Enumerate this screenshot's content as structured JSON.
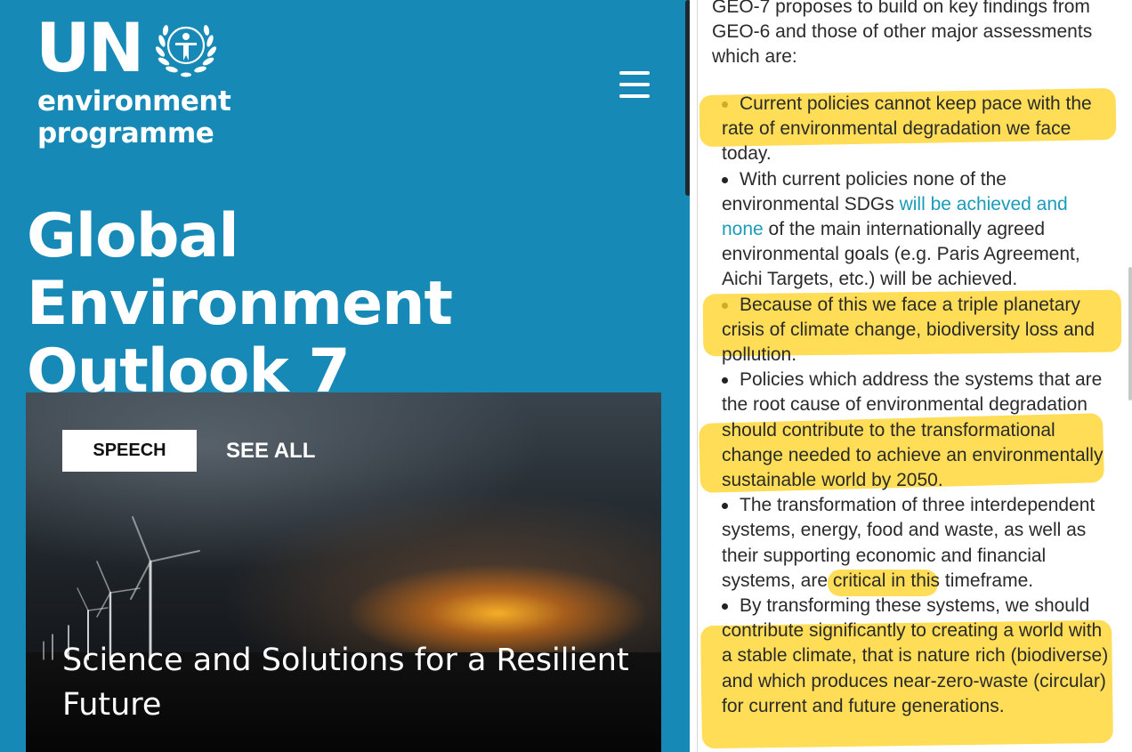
{
  "colors": {
    "brand_blue": "#1689b6",
    "highlight": "#ffd426",
    "link": "#1a9bb8"
  },
  "header": {
    "logo_un": "UN",
    "logo_line1": "environment",
    "logo_line2": "programme",
    "emblem_icon": "un-laurel-emblem-icon",
    "menu_icon": "hamburger-menu-icon"
  },
  "main": {
    "title_line1": "Global Environment",
    "title_line2": "Outlook 7"
  },
  "hero": {
    "tag_label": "SPEECH",
    "see_all_label": "SEE ALL",
    "headline_line1": "Science and Solutions for a Resilient",
    "headline_line2": "Future"
  },
  "article": {
    "intro_line1": "GEO-7 proposes to build on key findings from",
    "intro_line2": "GEO-6 and those of other major assessments",
    "intro_line3": "which are:",
    "findings": [
      {
        "text": "Current policies cannot keep pace with the rate of environmental degradation we face today."
      },
      {
        "text_before": "With current policies none of the environmental SDGs ",
        "link_text": "will be achieved and none",
        "text_after": " of the main internationally agreed environmental goals (e.g. Paris Agreement, Aichi Targets, etc.) will be achieved."
      },
      {
        "text": "Because of this we face a triple planetary crisis of climate change, biodiversity loss and pollution."
      },
      {
        "text": "Policies which address the systems that are the root cause of environmental degradation should contribute to the transformational change needed to achieve an environmentally sustainable world by 2050."
      },
      {
        "text": "The transformation of three interdependent systems, energy, food and waste, as well as their supporting economic and financial systems, are critical in this timeframe."
      },
      {
        "text": "By transforming these systems, we should contribute significantly to creating a world with a stable climate, that is nature rich (biodiverse) and which produces near-zero-waste (circular) for current and future generations."
      }
    ]
  }
}
